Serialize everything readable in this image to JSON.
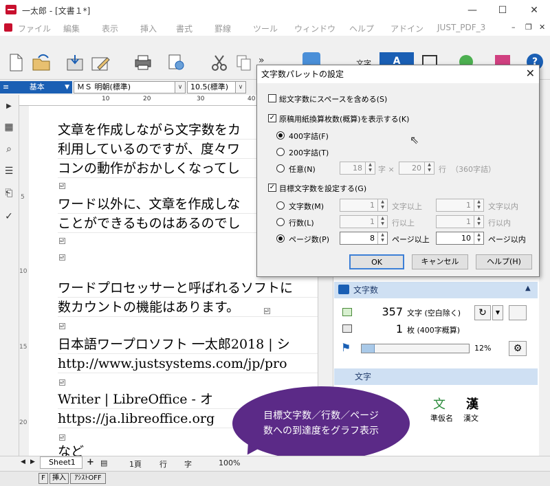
{
  "window": {
    "title": "一太郎 - [文書１*]",
    "minimize": "—",
    "maximize": "☐",
    "close": "✕"
  },
  "menu": [
    "ファイル",
    "編集",
    "表示",
    "挿入",
    "書式",
    "罫線",
    "ツール",
    "ウィンドウ",
    "ヘルプ",
    "アドイン",
    "JUST_PDF_3"
  ],
  "toolbar": {
    "more": "»",
    "mode_label": "文字"
  },
  "format": {
    "style": "基本",
    "font": "ＭＳ 明朝(標準)",
    "size": "10.5(標準)"
  },
  "ruler_ticks": [
    "10",
    "20",
    "30",
    "40"
  ],
  "vruler_ticks": [
    "5",
    "10",
    "15",
    "20"
  ],
  "document": {
    "lines": [
      "文章を作成しながら文字数をカ",
      "利用しているのですが、度々ワ",
      "コンの動作がおかしくなってし",
      "",
      "ワード以外に、文章を作成しな",
      "ことができるものはあるのでし",
      "",
      "",
      "ワードプロセッサーと呼ばれるソフトに",
      "数カウントの機能はあります。",
      "",
      "日本語ワープロソフト 一太郎2018 | シ",
      "http://www.justsystems.com/jp/pro",
      "",
      "Writer | LibreOffice - オ",
      "https://ja.libreoffice.org",
      "",
      "など"
    ],
    "para_mark": "⏎"
  },
  "dialog": {
    "title": "文字数パレットの設定",
    "close": "✕",
    "opt_space": "総文字数にスペースを含める(S)",
    "opt_manuscript": "原稿用紙換算枚数(概算)を表示する(K)",
    "r400": "400字詰(F)",
    "r200": "200字詰(T)",
    "rcustom": "任意(N)",
    "custom_chars": "18",
    "custom_lines": "20",
    "char_unit": "字 ×",
    "line_unit": "行",
    "custom_note": "（360字詰）",
    "opt_target": "目標文字数を設定する(G)",
    "t_chars": "文字数(M)",
    "t_lines": "行数(L)",
    "t_pages": "ページ数(P)",
    "chars_min": "1",
    "chars_max": "1",
    "lines_min": "1",
    "lines_max": "1",
    "pages_min": "8",
    "pages_max": "10",
    "chars_min_unit": "文字以上",
    "chars_max_unit": "文字以内",
    "lines_min_unit": "行以上",
    "lines_max_unit": "行以内",
    "pages_min_unit": "ページ以上",
    "pages_max_unit": "ページ以内",
    "ok": "OK",
    "cancel": "キャンセル",
    "help": "ヘルプ(H)",
    "check": "✓"
  },
  "palette": {
    "title": "文字数",
    "count": "357",
    "count_unit": "文字 (空白除く)",
    "sheets": "1",
    "sheets_unit": "枚 (400字概算)",
    "progress_pct": 12,
    "progress_label": "12%",
    "section2": "文字",
    "conv1": "準仮名",
    "conv2": "漢文",
    "conv2_glyph": "漢"
  },
  "callout": {
    "line1": "目標文字数／行数／ページ",
    "line2": "数への到達度をグラフ表示"
  },
  "status": {
    "sheet": "Sheet1",
    "page": "1頁",
    "line": "行",
    "char": "字",
    "zoom": "100%"
  },
  "bottom": {
    "f": "F",
    "insert": "挿入",
    "assist": "ｱｼｽﾄOFF"
  },
  "colors": {
    "accent": "#1a5fb4",
    "callout": "#5b2a87",
    "progress": "#a9c9e8"
  }
}
